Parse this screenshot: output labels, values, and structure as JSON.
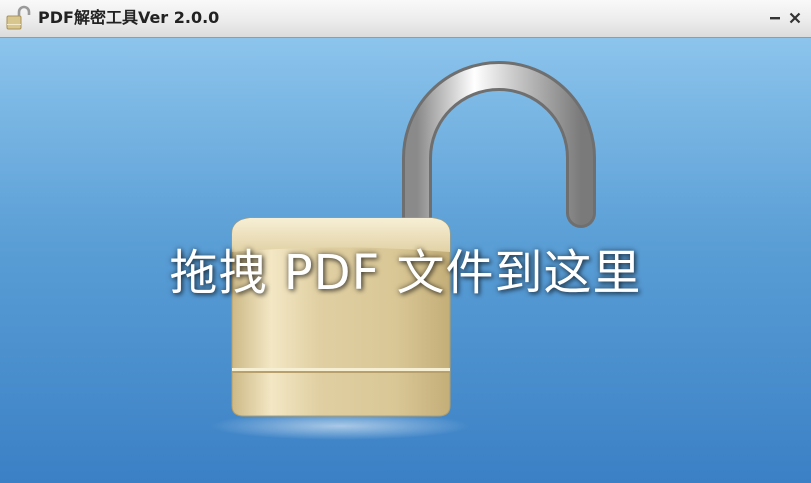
{
  "window": {
    "title": "PDF解密工具Ver 2.0.0",
    "title_icon": "padlock-icon"
  },
  "titlebar": {
    "minimize_icon": "minimize-icon",
    "close_icon": "close-icon"
  },
  "drop_area": {
    "hint": "拖拽 PDF 文件到这里",
    "illustration": "open-padlock-icon"
  },
  "colors": {
    "background_top": "#8cc4ec",
    "background_bottom": "#3b80c5",
    "lock_body": "#e4d4a8",
    "hint_text": "#ffffff"
  }
}
